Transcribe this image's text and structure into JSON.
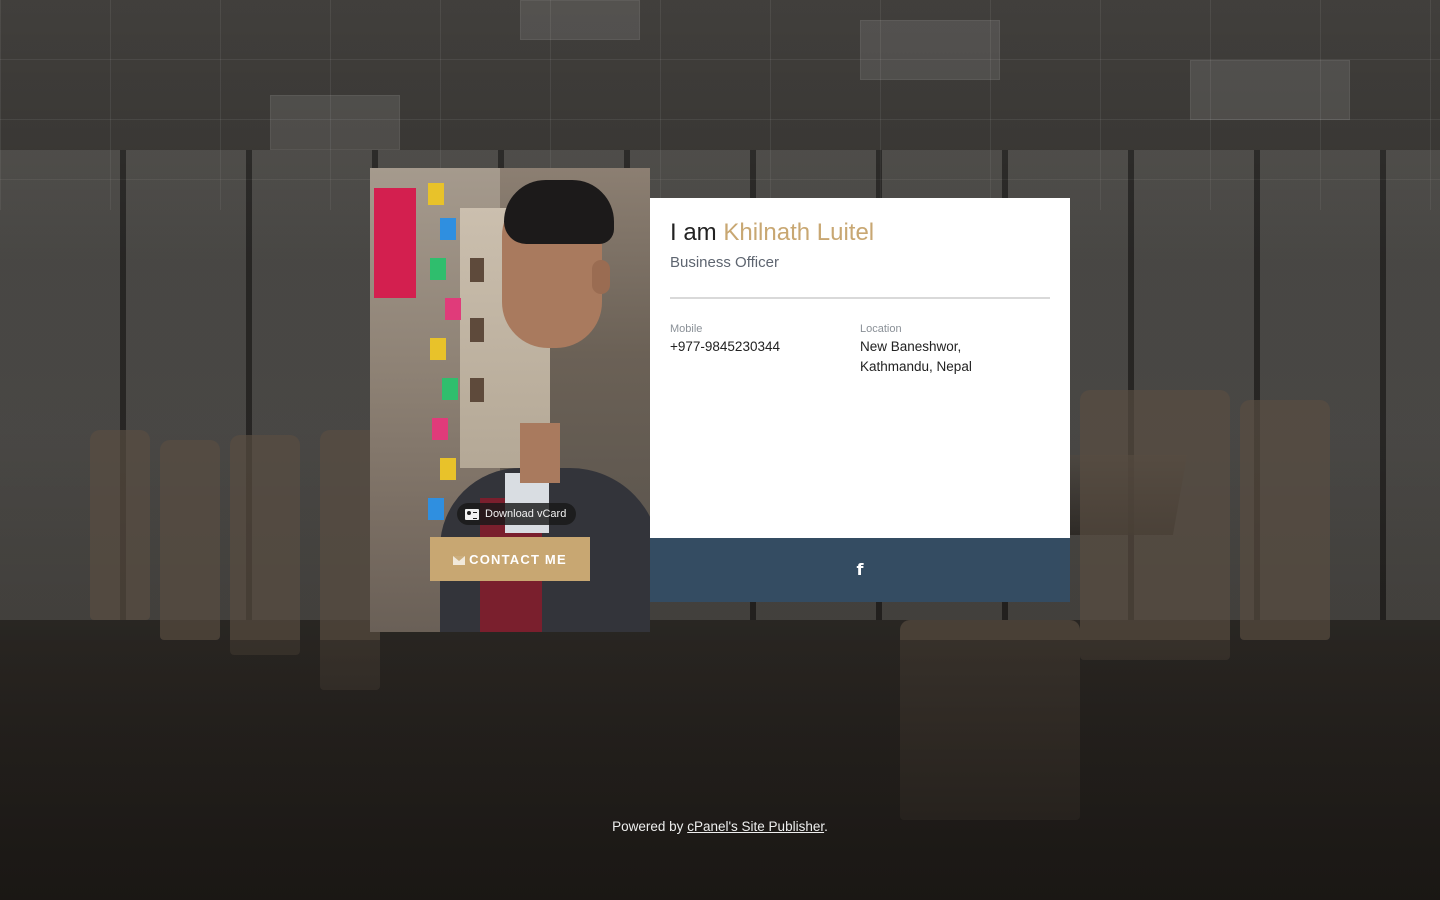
{
  "card": {
    "greeting": "I am",
    "name": "Khilnath Luitel",
    "role": "Business Officer",
    "mobile_label": "Mobile",
    "mobile_value": "+977-9845230344",
    "location_label": "Location",
    "location_line1": "New Baneshwor,",
    "location_line2": "Kathmandu, Nepal",
    "vcard_label": "Download vCard",
    "contact_label": "CONTACT ME",
    "social_icon": "facebook-icon"
  },
  "footer": {
    "prefix": "Powered by",
    "link": "cPanel's Site Publisher",
    "suffix": "."
  },
  "colors": {
    "accent": "#c8a772",
    "social_bar": "#344c62"
  }
}
